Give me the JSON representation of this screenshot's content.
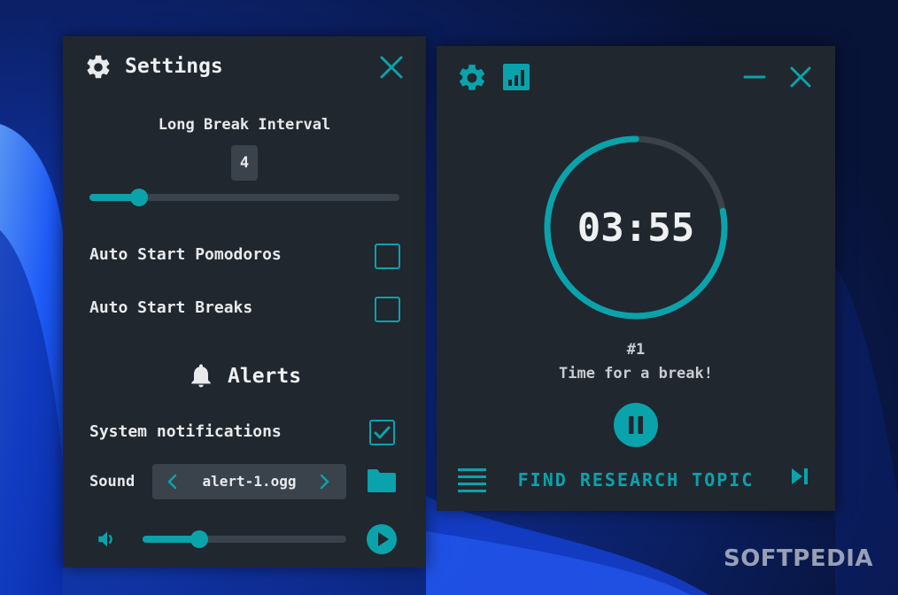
{
  "settings": {
    "title": "Settings",
    "long_break_label": "Long Break Interval",
    "long_break_value": "4",
    "long_break_slider_fraction": 0.16,
    "auto_start_pomodoros_label": "Auto Start Pomodoros",
    "auto_start_pomodoros_checked": false,
    "auto_start_breaks_label": "Auto Start Breaks",
    "auto_start_breaks_checked": false,
    "alerts_title": "Alerts",
    "system_notifications_label": "System notifications",
    "system_notifications_checked": true,
    "sound_label": "Sound",
    "sound_value": "alert-1.ogg",
    "volume_fraction": 0.28
  },
  "timer": {
    "time": "03:55",
    "round": "#1",
    "status": "Time for a break!",
    "task": "FIND RESEARCH TOPIC",
    "progress_fraction": 0.78
  },
  "watermark": "SOFTPEDIA",
  "colors": {
    "accent": "#0aa3ab",
    "panel": "#21272f",
    "track": "#3a424b"
  }
}
